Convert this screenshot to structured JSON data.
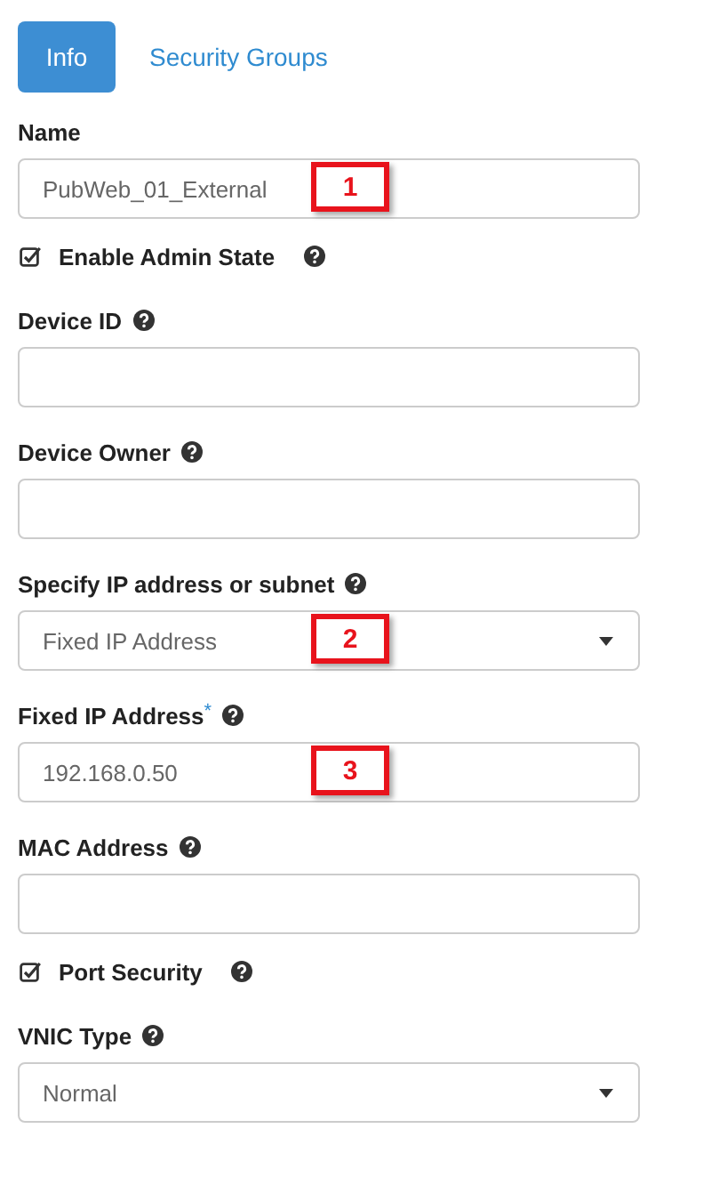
{
  "tabs": [
    {
      "label": "Info",
      "selected": true
    },
    {
      "label": "Security Groups",
      "selected": false
    }
  ],
  "fields": [
    {
      "kind": "text",
      "label": "Name",
      "value": "PubWeb_01_External",
      "callout": "1"
    },
    {
      "kind": "checkbox",
      "label": "Enable Admin State",
      "help": true,
      "checked": true
    },
    {
      "kind": "text",
      "label": "Device ID",
      "help": true
    },
    {
      "kind": "text",
      "label": "Device Owner",
      "help": true
    },
    {
      "kind": "select",
      "label": "Specify IP address or subnet",
      "help": true,
      "value": "Fixed IP Address",
      "callout": "2"
    },
    {
      "kind": "text",
      "label": "Fixed IP Address",
      "required_mark": "*",
      "help": true,
      "value": "192.168.0.50",
      "callout": "3"
    },
    {
      "kind": "text",
      "label": "MAC Address",
      "help": true
    },
    {
      "kind": "checkbox",
      "label": "Port Security",
      "help": true,
      "checked": true
    },
    {
      "kind": "select",
      "label": "VNIC Type",
      "help": true,
      "value": "Normal"
    }
  ]
}
